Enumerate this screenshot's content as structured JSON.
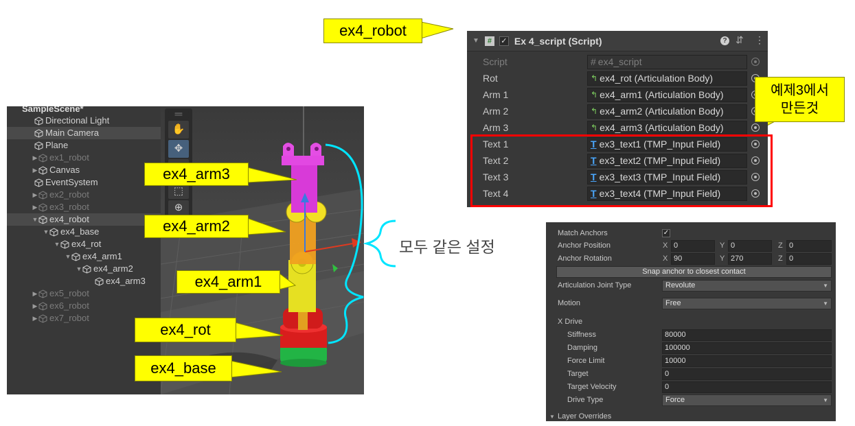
{
  "hierarchy": {
    "scene": "SampleScene*",
    "items": [
      {
        "label": "Directional Light"
      },
      {
        "label": "Main Camera"
      },
      {
        "label": "Plane"
      },
      {
        "label": "ex1_robot"
      },
      {
        "label": "Canvas"
      },
      {
        "label": "EventSystem"
      },
      {
        "label": "ex2_robot"
      },
      {
        "label": "ex3_robot"
      },
      {
        "label": "ex4_robot"
      },
      {
        "label": "ex4_base"
      },
      {
        "label": "ex4_rot"
      },
      {
        "label": "ex4_arm1"
      },
      {
        "label": "ex4_arm2"
      },
      {
        "label": "ex4_arm3"
      },
      {
        "label": "ex5_robot"
      },
      {
        "label": "ex6_robot"
      },
      {
        "label": "ex7_robot"
      }
    ]
  },
  "callouts": {
    "robot": "ex4_robot",
    "arm3": "ex4_arm3",
    "arm2": "ex4_arm2",
    "arm1": "ex4_arm1",
    "rot": "ex4_rot",
    "base": "ex4_base",
    "made_in_ex3": "예제3에서\n만든것",
    "same_setting": "모두 같은 설정"
  },
  "script_component": {
    "title": "Ex 4_script (Script)",
    "rows": [
      {
        "label": "Script",
        "value": "ex4_script"
      },
      {
        "label": "Rot",
        "value": "ex4_rot (Articulation Body)"
      },
      {
        "label": "Arm 1",
        "value": "ex4_arm1 (Articulation Body)"
      },
      {
        "label": "Arm 2",
        "value": "ex4_arm2 (Articulation Body)"
      },
      {
        "label": "Arm 3",
        "value": "ex4_arm3 (Articulation Body)"
      },
      {
        "label": "Text 1",
        "value": "ex3_text1 (TMP_Input Field)"
      },
      {
        "label": "Text 2",
        "value": "ex3_text2 (TMP_Input Field)"
      },
      {
        "label": "Text 3",
        "value": "ex3_text3 (TMP_Input Field)"
      },
      {
        "label": "Text 4",
        "value": "ex3_text4 (TMP_Input Field)"
      }
    ]
  },
  "articulation": {
    "match_anchors": "Match Anchors",
    "anchor_position": {
      "label": "Anchor Position",
      "x": "0",
      "y": "0",
      "z": "0"
    },
    "anchor_rotation": {
      "label": "Anchor Rotation",
      "x": "90",
      "y": "270",
      "z": "0"
    },
    "axis_x": "X",
    "axis_y": "Y",
    "axis_z": "Z",
    "snap_button": "Snap anchor to closest contact",
    "joint_type": {
      "label": "Articulation Joint Type",
      "value": "Revolute"
    },
    "motion": {
      "label": "Motion",
      "value": "Free"
    },
    "x_drive": "X Drive",
    "stiffness": {
      "label": "Stiffness",
      "value": "80000"
    },
    "damping": {
      "label": "Damping",
      "value": "100000"
    },
    "force_limit": {
      "label": "Force Limit",
      "value": "10000"
    },
    "target": {
      "label": "Target",
      "value": "0"
    },
    "target_velocity": {
      "label": "Target Velocity",
      "value": "0"
    },
    "drive_type": {
      "label": "Drive Type",
      "value": "Force"
    },
    "layer_overrides": "Layer Overrides"
  },
  "colors": {
    "callout_yellow": "#ffff00",
    "highlight_red": "#ff0000",
    "bracket_cyan": "#00e5ff",
    "arm_magenta": "#e040e0",
    "arm_yellow": "#e8e020",
    "base_red": "#e02020",
    "base_green": "#20c040"
  }
}
